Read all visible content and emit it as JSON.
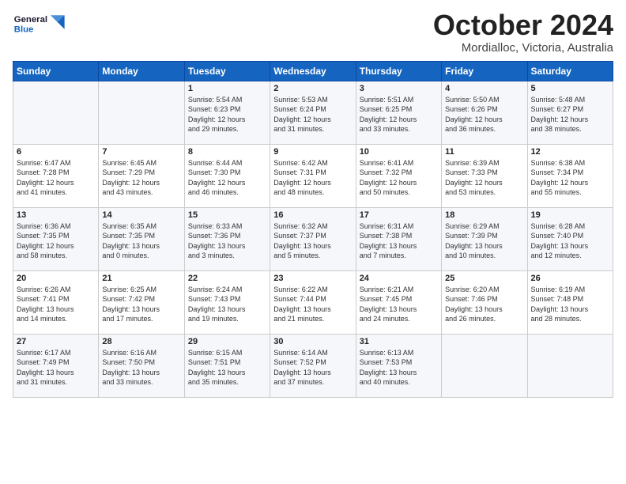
{
  "header": {
    "logo_line1": "General",
    "logo_line2": "Blue",
    "month": "October 2024",
    "location": "Mordialloc, Victoria, Australia"
  },
  "weekdays": [
    "Sunday",
    "Monday",
    "Tuesday",
    "Wednesday",
    "Thursday",
    "Friday",
    "Saturday"
  ],
  "weeks": [
    [
      {
        "day": "",
        "info": ""
      },
      {
        "day": "",
        "info": ""
      },
      {
        "day": "1",
        "info": "Sunrise: 5:54 AM\nSunset: 6:23 PM\nDaylight: 12 hours\nand 29 minutes."
      },
      {
        "day": "2",
        "info": "Sunrise: 5:53 AM\nSunset: 6:24 PM\nDaylight: 12 hours\nand 31 minutes."
      },
      {
        "day": "3",
        "info": "Sunrise: 5:51 AM\nSunset: 6:25 PM\nDaylight: 12 hours\nand 33 minutes."
      },
      {
        "day": "4",
        "info": "Sunrise: 5:50 AM\nSunset: 6:26 PM\nDaylight: 12 hours\nand 36 minutes."
      },
      {
        "day": "5",
        "info": "Sunrise: 5:48 AM\nSunset: 6:27 PM\nDaylight: 12 hours\nand 38 minutes."
      }
    ],
    [
      {
        "day": "6",
        "info": "Sunrise: 6:47 AM\nSunset: 7:28 PM\nDaylight: 12 hours\nand 41 minutes."
      },
      {
        "day": "7",
        "info": "Sunrise: 6:45 AM\nSunset: 7:29 PM\nDaylight: 12 hours\nand 43 minutes."
      },
      {
        "day": "8",
        "info": "Sunrise: 6:44 AM\nSunset: 7:30 PM\nDaylight: 12 hours\nand 46 minutes."
      },
      {
        "day": "9",
        "info": "Sunrise: 6:42 AM\nSunset: 7:31 PM\nDaylight: 12 hours\nand 48 minutes."
      },
      {
        "day": "10",
        "info": "Sunrise: 6:41 AM\nSunset: 7:32 PM\nDaylight: 12 hours\nand 50 minutes."
      },
      {
        "day": "11",
        "info": "Sunrise: 6:39 AM\nSunset: 7:33 PM\nDaylight: 12 hours\nand 53 minutes."
      },
      {
        "day": "12",
        "info": "Sunrise: 6:38 AM\nSunset: 7:34 PM\nDaylight: 12 hours\nand 55 minutes."
      }
    ],
    [
      {
        "day": "13",
        "info": "Sunrise: 6:36 AM\nSunset: 7:35 PM\nDaylight: 12 hours\nand 58 minutes."
      },
      {
        "day": "14",
        "info": "Sunrise: 6:35 AM\nSunset: 7:35 PM\nDaylight: 13 hours\nand 0 minutes."
      },
      {
        "day": "15",
        "info": "Sunrise: 6:33 AM\nSunset: 7:36 PM\nDaylight: 13 hours\nand 3 minutes."
      },
      {
        "day": "16",
        "info": "Sunrise: 6:32 AM\nSunset: 7:37 PM\nDaylight: 13 hours\nand 5 minutes."
      },
      {
        "day": "17",
        "info": "Sunrise: 6:31 AM\nSunset: 7:38 PM\nDaylight: 13 hours\nand 7 minutes."
      },
      {
        "day": "18",
        "info": "Sunrise: 6:29 AM\nSunset: 7:39 PM\nDaylight: 13 hours\nand 10 minutes."
      },
      {
        "day": "19",
        "info": "Sunrise: 6:28 AM\nSunset: 7:40 PM\nDaylight: 13 hours\nand 12 minutes."
      }
    ],
    [
      {
        "day": "20",
        "info": "Sunrise: 6:26 AM\nSunset: 7:41 PM\nDaylight: 13 hours\nand 14 minutes."
      },
      {
        "day": "21",
        "info": "Sunrise: 6:25 AM\nSunset: 7:42 PM\nDaylight: 13 hours\nand 17 minutes."
      },
      {
        "day": "22",
        "info": "Sunrise: 6:24 AM\nSunset: 7:43 PM\nDaylight: 13 hours\nand 19 minutes."
      },
      {
        "day": "23",
        "info": "Sunrise: 6:22 AM\nSunset: 7:44 PM\nDaylight: 13 hours\nand 21 minutes."
      },
      {
        "day": "24",
        "info": "Sunrise: 6:21 AM\nSunset: 7:45 PM\nDaylight: 13 hours\nand 24 minutes."
      },
      {
        "day": "25",
        "info": "Sunrise: 6:20 AM\nSunset: 7:46 PM\nDaylight: 13 hours\nand 26 minutes."
      },
      {
        "day": "26",
        "info": "Sunrise: 6:19 AM\nSunset: 7:48 PM\nDaylight: 13 hours\nand 28 minutes."
      }
    ],
    [
      {
        "day": "27",
        "info": "Sunrise: 6:17 AM\nSunset: 7:49 PM\nDaylight: 13 hours\nand 31 minutes."
      },
      {
        "day": "28",
        "info": "Sunrise: 6:16 AM\nSunset: 7:50 PM\nDaylight: 13 hours\nand 33 minutes."
      },
      {
        "day": "29",
        "info": "Sunrise: 6:15 AM\nSunset: 7:51 PM\nDaylight: 13 hours\nand 35 minutes."
      },
      {
        "day": "30",
        "info": "Sunrise: 6:14 AM\nSunset: 7:52 PM\nDaylight: 13 hours\nand 37 minutes."
      },
      {
        "day": "31",
        "info": "Sunrise: 6:13 AM\nSunset: 7:53 PM\nDaylight: 13 hours\nand 40 minutes."
      },
      {
        "day": "",
        "info": ""
      },
      {
        "day": "",
        "info": ""
      }
    ]
  ]
}
